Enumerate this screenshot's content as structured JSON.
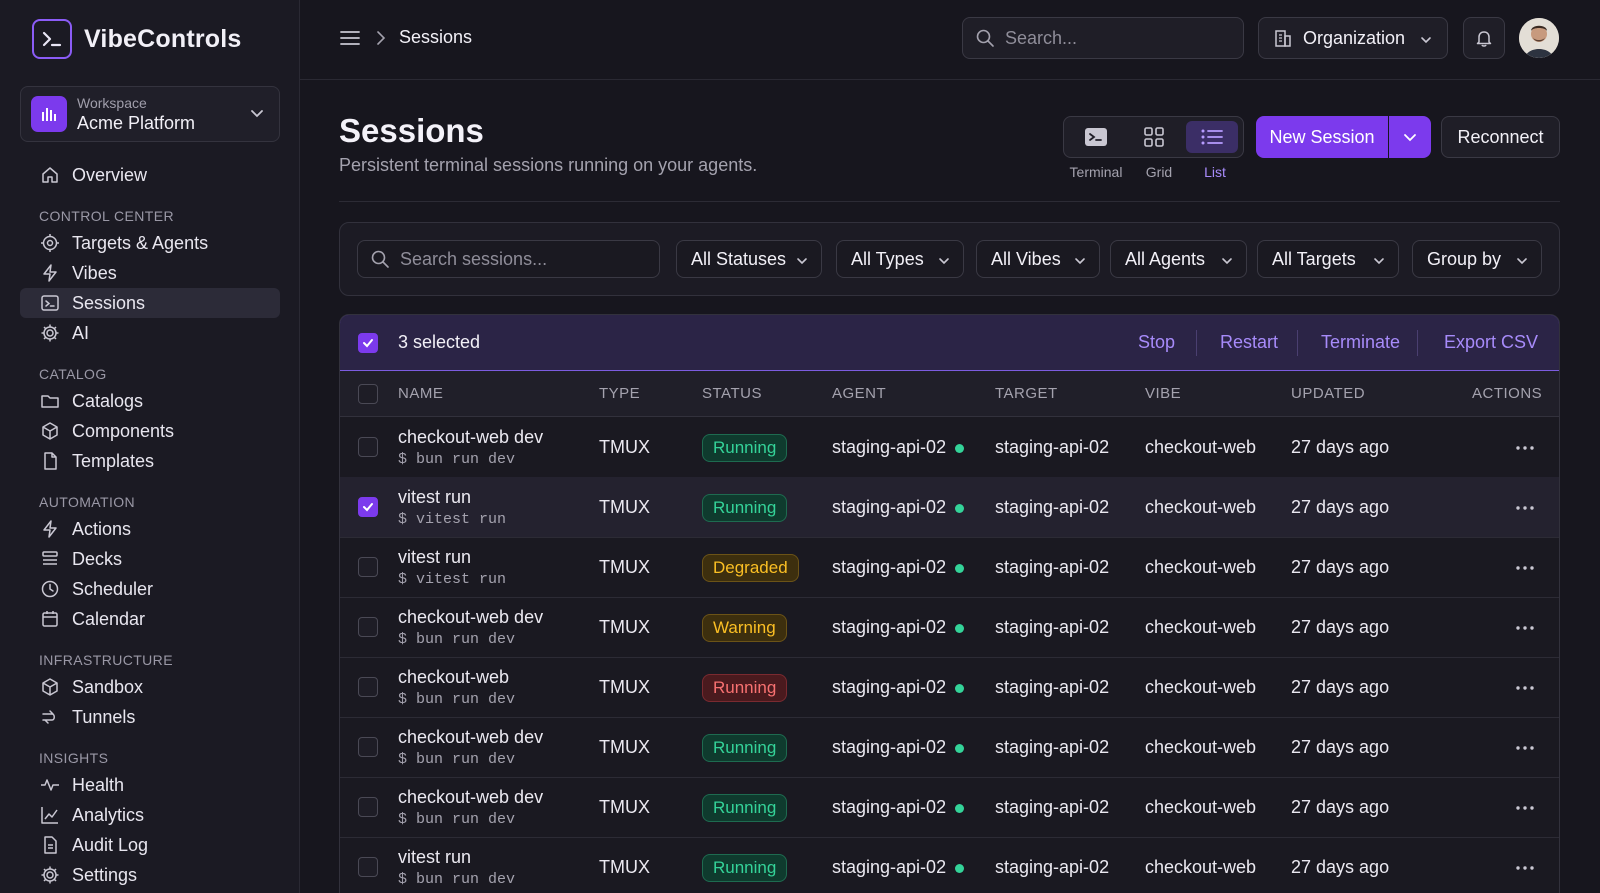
{
  "brand": {
    "name": "VibeControls"
  },
  "workspace": {
    "label": "Workspace",
    "name": "Acme Platform"
  },
  "nav": {
    "overview": "Overview",
    "sections": {
      "control_center": "CONTROL CENTER",
      "catalog": "CATALOG",
      "automation": "AUTOMATION",
      "infrastructure": "INFRASTRUCTURE",
      "insights": "INSIGHTS"
    },
    "control_center": [
      "Targets & Agents",
      "Vibes",
      "Sessions",
      "AI"
    ],
    "catalog": [
      "Catalogs",
      "Components",
      "Templates"
    ],
    "automation": [
      "Actions",
      "Decks",
      "Scheduler",
      "Calendar"
    ],
    "infrastructure": [
      "Sandbox",
      "Tunnels"
    ],
    "insights": [
      "Health",
      "Analytics",
      "Audit Log",
      "Settings"
    ],
    "active": "Sessions"
  },
  "topbar": {
    "breadcrumb": "Sessions",
    "search_placeholder": "Search...",
    "org_label": "Organization"
  },
  "page": {
    "title": "Sessions",
    "subtitle": "Persistent terminal sessions running on your agents."
  },
  "view_toggle": {
    "options": [
      "Terminal",
      "Grid",
      "List"
    ],
    "active": "List"
  },
  "actions": {
    "new_session": "New Session",
    "reconnect": "Reconnect"
  },
  "filters": {
    "search_placeholder": "Search sessions...",
    "statuses": "All Statuses",
    "types": "All Types",
    "vibes": "All Vibes",
    "agents": "All Agents",
    "targets": "All Targets",
    "group_by": "Group by"
  },
  "selection": {
    "text": "3 selected",
    "stop": "Stop",
    "restart": "Restart",
    "terminate": "Terminate",
    "export": "Export CSV"
  },
  "columns": [
    "NAME",
    "TYPE",
    "STATUS",
    "AGENT",
    "TARGET",
    "VIBE",
    "UPDATED",
    "ACTIONS"
  ],
  "status_colors": {
    "running": "#34d399",
    "degraded": "#fbbf24",
    "warning": "#fbbf24",
    "error": "#f87171",
    "accent": "#7c3aed"
  },
  "rows": [
    {
      "name": "checkout-web dev",
      "command": "$ bun run dev",
      "type": "TMUX",
      "status": "Running",
      "status_kind": "running",
      "agent": "staging-api-02",
      "target": "staging-api-02",
      "vibe": "checkout-web",
      "updated": "27 days ago",
      "selected": false
    },
    {
      "name": "vitest run",
      "command": "$ vitest run",
      "type": "TMUX",
      "status": "Running",
      "status_kind": "running",
      "agent": "staging-api-02",
      "target": "staging-api-02",
      "vibe": "checkout-web",
      "updated": "27 days ago",
      "selected": true
    },
    {
      "name": "vitest run",
      "command": "$ vitest run",
      "type": "TMUX",
      "status": "Degraded",
      "status_kind": "degraded",
      "agent": "staging-api-02",
      "target": "staging-api-02",
      "vibe": "checkout-web",
      "updated": "27 days ago",
      "selected": false
    },
    {
      "name": "checkout-web dev",
      "command": "$ bun run dev",
      "type": "TMUX",
      "status": "Warning",
      "status_kind": "warning",
      "agent": "staging-api-02",
      "target": "staging-api-02",
      "vibe": "checkout-web",
      "updated": "27 days ago",
      "selected": false
    },
    {
      "name": "checkout-web",
      "command": "$ bun run dev",
      "type": "TMUX",
      "status": "Running",
      "status_kind": "error",
      "agent": "staging-api-02",
      "target": "staging-api-02",
      "vibe": "checkout-web",
      "updated": "27 days ago",
      "selected": false
    },
    {
      "name": "checkout-web dev",
      "command": "$ bun run dev",
      "type": "TMUX",
      "status": "Running",
      "status_kind": "running",
      "agent": "staging-api-02",
      "target": "staging-api-02",
      "vibe": "checkout-web",
      "updated": "27 days ago",
      "selected": false
    },
    {
      "name": "checkout-web dev",
      "command": "$ bun run dev",
      "type": "TMUX",
      "status": "Running",
      "status_kind": "running",
      "agent": "staging-api-02",
      "target": "staging-api-02",
      "vibe": "checkout-web",
      "updated": "27 days ago",
      "selected": false
    },
    {
      "name": "vitest run",
      "command": "$ bun run dev",
      "type": "TMUX",
      "status": "Running",
      "status_kind": "running",
      "agent": "staging-api-02",
      "target": "staging-api-02",
      "vibe": "checkout-web",
      "updated": "27 days ago",
      "selected": false
    }
  ]
}
